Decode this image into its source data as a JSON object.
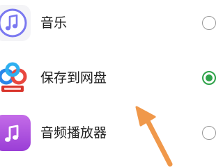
{
  "options": [
    {
      "label": "音乐",
      "icon": "music-note-icon",
      "selected": false
    },
    {
      "label": "保存到网盘",
      "icon": "cloud-drive-icon",
      "selected": true
    },
    {
      "label": "音频播放器",
      "icon": "music-note-icon",
      "selected": false
    }
  ],
  "colors": {
    "selected_green": "#2fa34a",
    "radio_border": "#9a9a9a",
    "annotation_arrow": "#f0984a"
  }
}
